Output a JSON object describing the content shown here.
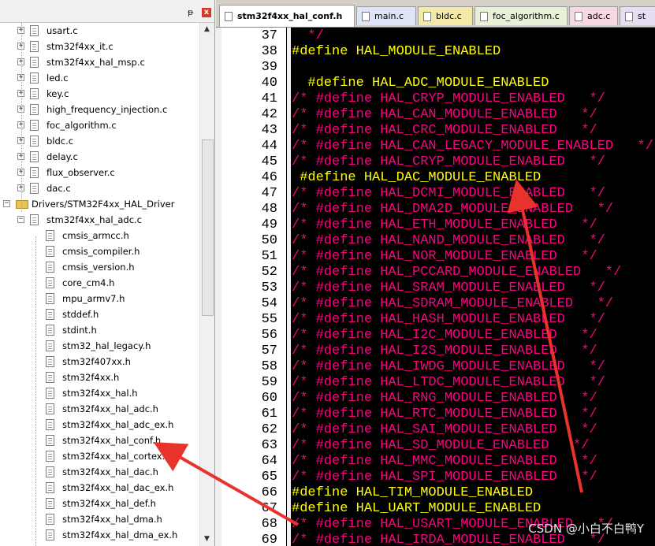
{
  "panel": {
    "close_label": "x",
    "pin_label": "ᵽ",
    "items": [
      {
        "label": "usart.c",
        "kind": "file",
        "level": 1
      },
      {
        "label": "stm32f4xx_it.c",
        "kind": "file",
        "level": 1
      },
      {
        "label": "stm32f4xx_hal_msp.c",
        "kind": "file",
        "level": 1
      },
      {
        "label": "led.c",
        "kind": "file",
        "level": 1
      },
      {
        "label": "key.c",
        "kind": "file",
        "level": 1
      },
      {
        "label": "high_frequency_injection.c",
        "kind": "file",
        "level": 1
      },
      {
        "label": "foc_algorithm.c",
        "kind": "file",
        "level": 1
      },
      {
        "label": "bldc.c",
        "kind": "file",
        "level": 1
      },
      {
        "label": "delay.c",
        "kind": "file",
        "level": 1
      },
      {
        "label": "flux_observer.c",
        "kind": "file",
        "level": 1
      },
      {
        "label": "dac.c",
        "kind": "file",
        "level": 1
      },
      {
        "label": "Drivers/STM32F4xx_HAL_Driver",
        "kind": "folder",
        "level": 0
      },
      {
        "label": "stm32f4xx_hal_adc.c",
        "kind": "file",
        "level": 1
      },
      {
        "label": "cmsis_armcc.h",
        "kind": "header",
        "level": 2
      },
      {
        "label": "cmsis_compiler.h",
        "kind": "header",
        "level": 2
      },
      {
        "label": "cmsis_version.h",
        "kind": "header",
        "level": 2
      },
      {
        "label": "core_cm4.h",
        "kind": "header",
        "level": 2
      },
      {
        "label": "mpu_armv7.h",
        "kind": "header",
        "level": 2
      },
      {
        "label": "stddef.h",
        "kind": "header",
        "level": 2
      },
      {
        "label": "stdint.h",
        "kind": "header",
        "level": 2
      },
      {
        "label": "stm32_hal_legacy.h",
        "kind": "header",
        "level": 2
      },
      {
        "label": "stm32f407xx.h",
        "kind": "header",
        "level": 2
      },
      {
        "label": "stm32f4xx.h",
        "kind": "header",
        "level": 2
      },
      {
        "label": "stm32f4xx_hal.h",
        "kind": "header",
        "level": 2
      },
      {
        "label": "stm32f4xx_hal_adc.h",
        "kind": "header",
        "level": 2
      },
      {
        "label": "stm32f4xx_hal_adc_ex.h",
        "kind": "header",
        "level": 2
      },
      {
        "label": "stm32f4xx_hal_conf.h",
        "kind": "header",
        "level": 2
      },
      {
        "label": "stm32f4xx_hal_cortex.h",
        "kind": "header",
        "level": 2
      },
      {
        "label": "stm32f4xx_hal_dac.h",
        "kind": "header",
        "level": 2
      },
      {
        "label": "stm32f4xx_hal_dac_ex.h",
        "kind": "header",
        "level": 2
      },
      {
        "label": "stm32f4xx_hal_def.h",
        "kind": "header",
        "level": 2
      },
      {
        "label": "stm32f4xx_hal_dma.h",
        "kind": "header",
        "level": 2
      },
      {
        "label": "stm32f4xx_hal_dma_ex.h",
        "kind": "header",
        "level": 2
      }
    ]
  },
  "tabs": [
    {
      "label": "stm32f4xx_hal_conf.h",
      "active": true,
      "color": "#ffffff"
    },
    {
      "label": "main.c",
      "active": false,
      "color": "#dce4f5"
    },
    {
      "label": "bldc.c",
      "active": false,
      "color": "#f5e9a8"
    },
    {
      "label": "foc_algorithm.c",
      "active": false,
      "color": "#e8f0d8"
    },
    {
      "label": "adc.c",
      "active": false,
      "color": "#f6d9e0"
    },
    {
      "label": "st",
      "active": false,
      "color": "#e6ddf2"
    }
  ],
  "editor": {
    "lines": [
      {
        "n": "37",
        "segs": [
          {
            "t": "  */",
            "c": "cmt"
          }
        ]
      },
      {
        "n": "38",
        "segs": [
          {
            "t": "#define HAL_MODULE_ENABLED",
            "c": "def"
          }
        ]
      },
      {
        "n": "39",
        "segs": []
      },
      {
        "n": "40",
        "segs": [
          {
            "t": "  #define HAL_ADC_MODULE_ENABLED",
            "c": "def"
          }
        ]
      },
      {
        "n": "41",
        "segs": [
          {
            "t": "/* #define HAL_CRYP_MODULE_ENABLED   */",
            "c": "cmt"
          }
        ]
      },
      {
        "n": "42",
        "segs": [
          {
            "t": "/* #define HAL_CAN_MODULE_ENABLED   */",
            "c": "cmt"
          }
        ]
      },
      {
        "n": "43",
        "segs": [
          {
            "t": "/* #define HAL_CRC_MODULE_ENABLED   */",
            "c": "cmt"
          }
        ]
      },
      {
        "n": "44",
        "segs": [
          {
            "t": "/* #define HAL_CAN_LEGACY_MODULE_ENABLED   */",
            "c": "cmt"
          }
        ]
      },
      {
        "n": "45",
        "segs": [
          {
            "t": "/* #define HAL_CRYP_MODULE_ENABLED   */",
            "c": "cmt"
          }
        ]
      },
      {
        "n": "46",
        "segs": [
          {
            "t": " #define HAL_DAC_MODULE_ENABLED",
            "c": "def"
          }
        ]
      },
      {
        "n": "47",
        "segs": [
          {
            "t": "/* #define HAL_DCMI_MODULE_ENABLED   */",
            "c": "cmt"
          }
        ]
      },
      {
        "n": "48",
        "segs": [
          {
            "t": "/* #define HAL_DMA2D_MODULE_ENABLED   */",
            "c": "cmt"
          }
        ]
      },
      {
        "n": "49",
        "segs": [
          {
            "t": "/* #define HAL_ETH_MODULE_ENABLED   */",
            "c": "cmt"
          }
        ]
      },
      {
        "n": "50",
        "segs": [
          {
            "t": "/* #define HAL_NAND_MODULE_ENABLED   */",
            "c": "cmt"
          }
        ]
      },
      {
        "n": "51",
        "segs": [
          {
            "t": "/* #define HAL_NOR_MODULE_ENABLED   */",
            "c": "cmt"
          }
        ]
      },
      {
        "n": "52",
        "segs": [
          {
            "t": "/* #define HAL_PCCARD_MODULE_ENABLED   */",
            "c": "cmt"
          }
        ]
      },
      {
        "n": "53",
        "segs": [
          {
            "t": "/* #define HAL_SRAM_MODULE_ENABLED   */",
            "c": "cmt"
          }
        ]
      },
      {
        "n": "54",
        "segs": [
          {
            "t": "/* #define HAL_SDRAM_MODULE_ENABLED   */",
            "c": "cmt"
          }
        ]
      },
      {
        "n": "55",
        "segs": [
          {
            "t": "/* #define HAL_HASH_MODULE_ENABLED   */",
            "c": "cmt"
          }
        ]
      },
      {
        "n": "56",
        "segs": [
          {
            "t": "/* #define HAL_I2C_MODULE_ENABLED   */",
            "c": "cmt"
          }
        ]
      },
      {
        "n": "57",
        "segs": [
          {
            "t": "/* #define HAL_I2S_MODULE_ENABLED   */",
            "c": "cmt"
          }
        ]
      },
      {
        "n": "58",
        "segs": [
          {
            "t": "/* #define HAL_IWDG_MODULE_ENABLED   */",
            "c": "cmt"
          }
        ]
      },
      {
        "n": "59",
        "segs": [
          {
            "t": "/* #define HAL_LTDC_MODULE_ENABLED   */",
            "c": "cmt"
          }
        ]
      },
      {
        "n": "60",
        "segs": [
          {
            "t": "/* #define HAL_RNG_MODULE_ENABLED   */",
            "c": "cmt"
          }
        ]
      },
      {
        "n": "61",
        "segs": [
          {
            "t": "/* #define HAL_RTC_MODULE_ENABLED   */",
            "c": "cmt"
          }
        ]
      },
      {
        "n": "62",
        "segs": [
          {
            "t": "/* #define HAL_SAI_MODULE_ENABLED   */",
            "c": "cmt"
          }
        ]
      },
      {
        "n": "63",
        "segs": [
          {
            "t": "/* #define HAL_SD_MODULE_ENABLED   */",
            "c": "cmt"
          }
        ]
      },
      {
        "n": "64",
        "segs": [
          {
            "t": "/* #define HAL_MMC_MODULE_ENABLED   */",
            "c": "cmt"
          }
        ]
      },
      {
        "n": "65",
        "segs": [
          {
            "t": "/* #define HAL_SPI_MODULE_ENABLED   */",
            "c": "cmt"
          }
        ]
      },
      {
        "n": "66",
        "segs": [
          {
            "t": "#define HAL_TIM_MODULE_ENABLED",
            "c": "def"
          }
        ]
      },
      {
        "n": "67",
        "segs": [
          {
            "t": "#define HAL_UART_MODULE_ENABLED",
            "c": "def"
          }
        ]
      },
      {
        "n": "68",
        "segs": [
          {
            "t": "/* #define HAL_USART_MODULE_ENABLED   */",
            "c": "cmt"
          }
        ]
      },
      {
        "n": "69",
        "segs": [
          {
            "t": "/* #define HAL_IRDA_MODULE_ENABLED   */",
            "c": "cmt"
          }
        ]
      }
    ]
  },
  "watermark": "CSDN @小白不白鸭Y",
  "colors": {
    "editor_bg": "#000000",
    "define": "#ffff00",
    "comment": "#ff0080",
    "arrow": "#e8322c"
  }
}
